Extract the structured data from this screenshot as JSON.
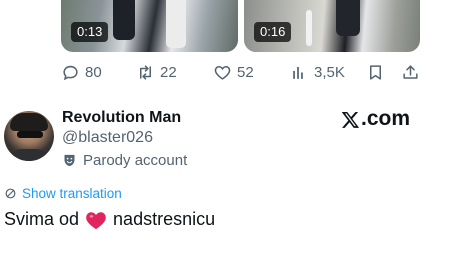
{
  "media": [
    {
      "duration": "0:13"
    },
    {
      "duration": "0:16"
    }
  ],
  "actions": {
    "replies": "80",
    "reposts": "22",
    "likes": "52",
    "views": "3,5K"
  },
  "author": {
    "name": "Revolution Man",
    "handle": "@blaster026",
    "label": "Parody account"
  },
  "brand": {
    "suffix": ".com"
  },
  "translate": {
    "label": "Show translation"
  },
  "tweet": {
    "text_before": "Svima od",
    "emoji": "❤️",
    "text_after": "nadstresnicu"
  },
  "colors": {
    "accent": "#1d9bf0",
    "muted": "#536471",
    "heart": "#e0245e"
  }
}
